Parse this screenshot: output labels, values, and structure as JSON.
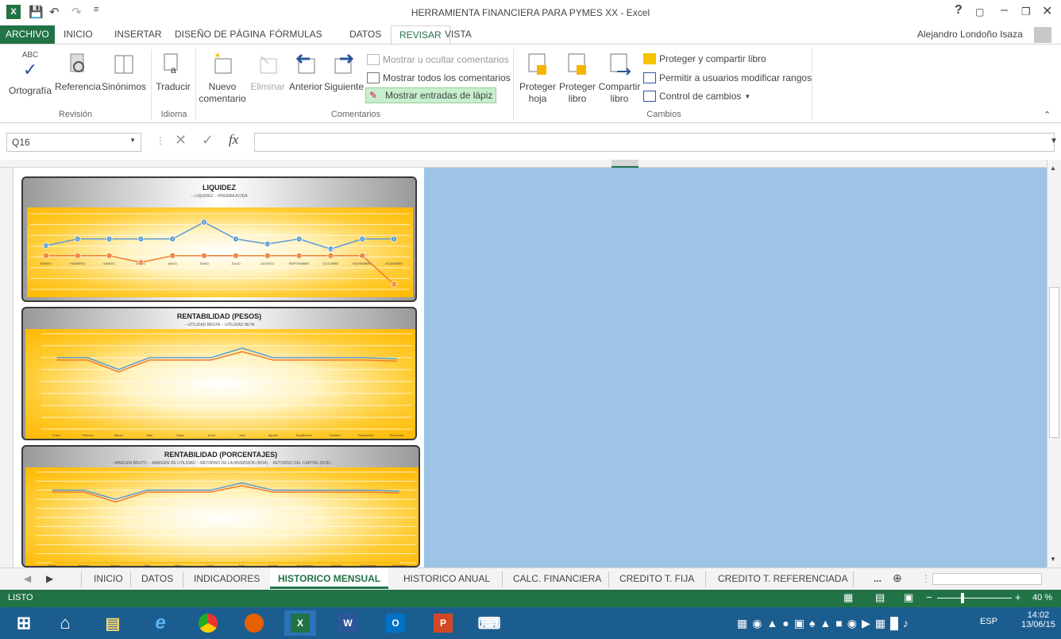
{
  "window": {
    "title": "HERRAMIENTA FINANCIERA PARA PYMES XX - Excel",
    "user": "Alejandro Londoño Isaza",
    "help": "?"
  },
  "tabs": [
    "ARCHIVO",
    "INICIO",
    "INSERTAR",
    "DISEÑO DE PÁGINA",
    "FÓRMULAS",
    "DATOS",
    "REVISAR",
    "VISTA"
  ],
  "ribbon": {
    "groups": {
      "revision": "Revisión",
      "idioma": "Idioma",
      "comentarios": "Comentarios",
      "cambios": "Cambios"
    },
    "abc": "ABC",
    "ortografia": "Ortografía",
    "referencia": "Referencia",
    "sinonimos": "Sinónimos",
    "traducir": "Traducir",
    "nuevo1": "Nuevo",
    "nuevo2": "comentario",
    "eliminar": "Eliminar",
    "anterior": "Anterior",
    "siguiente": "Siguiente",
    "mostrar_ocultar": "Mostrar u ocultar comentarios",
    "mostrar_todos": "Mostrar todos los comentarios",
    "mostrar_lapiz": "Mostrar entradas de lápiz",
    "proteger_hoja1": "Proteger",
    "proteger_hoja2": "hoja",
    "proteger_libro1": "Proteger",
    "proteger_libro2": "libro",
    "compartir1": "Compartir",
    "compartir2": "libro",
    "proteger_compartir": "Proteger y compartir libro",
    "permitir": "Permitir a usuarios modificar rangos",
    "control": "Control de cambios"
  },
  "formula": {
    "namebox": "Q16",
    "fx": "fx",
    "value": ""
  },
  "charts": {
    "liquidez": {
      "title": "LIQUIDEZ",
      "legend": [
        "LIQUIDEZ",
        "PRUEBA ACIDA"
      ]
    },
    "rent_pesos": {
      "title": "RENTABILIDAD (PESOS)",
      "legend": [
        "UTILIDAD BRUTA",
        "UTILIDAD NETA"
      ]
    },
    "rent_pct": {
      "title": "RENTABILIDAD (PORCENTAJES)",
      "legend": [
        "MARGEN BRUTO",
        "MARGEN DE UTILIDAD",
        "RETORNO DE LA INVERSIÓN (ROA)",
        "RETORNO DEL CAPITAL (ROE)"
      ]
    }
  },
  "chart_data": [
    {
      "type": "line",
      "title": "LIQUIDEZ",
      "categories": [
        "ENERO",
        "FEBRERO",
        "MARZO",
        "ABRIL",
        "MAYO",
        "JUNIO",
        "JULIO",
        "AGOSTO",
        "SEPTIEMBRE",
        "OCTUBRE",
        "NOVIEMBRE",
        "DICIEMBRE"
      ],
      "series": [
        {
          "name": "LIQUIDEZ",
          "values": [
            1.6,
            2,
            2,
            2,
            2,
            3,
            2,
            1.7,
            2,
            1.4,
            2,
            2
          ]
        },
        {
          "name": "PRUEBA ACIDA",
          "values": [
            1,
            1,
            1,
            0.6,
            1,
            1,
            1,
            1,
            1,
            1,
            1,
            -0.7
          ]
        }
      ],
      "ylim": [
        -1,
        3.5
      ]
    },
    {
      "type": "line",
      "title": "RENTABILIDAD (PESOS)",
      "categories": [
        "Enero",
        "Febrero",
        "Marzo",
        "Abril",
        "Mayo",
        "Junio",
        "Julio",
        "Agosto",
        "Septiembre",
        "Octubre",
        "Noviembre",
        "Diciembre"
      ],
      "series": [
        {
          "name": "UTILIDAD BRUTA",
          "values": [
            600,
            600,
            500,
            600,
            600,
            600,
            680,
            600,
            600,
            600,
            600,
            590
          ]
        },
        {
          "name": "UTILIDAD NETA",
          "values": [
            580,
            580,
            480,
            580,
            580,
            580,
            650,
            580,
            580,
            580,
            580,
            570
          ]
        }
      ],
      "ylim": [
        0,
        800
      ]
    },
    {
      "type": "line",
      "title": "RENTABILIDAD (PORCENTAJES)",
      "categories": [
        "Enero",
        "Febrero",
        "Marzo",
        "Abril",
        "Mayo",
        "Junio",
        "Julio",
        "Agosto",
        "Septiembre",
        "Octubre",
        "Noviembre",
        "Diciembre"
      ],
      "series": [
        {
          "name": "MARGEN BRUTO",
          "values": [
            80,
            80,
            70,
            80,
            80,
            80,
            88,
            80,
            80,
            80,
            80,
            79
          ]
        },
        {
          "name": "MARGEN DE UTILIDAD",
          "values": [
            78,
            78,
            67,
            78,
            78,
            78,
            85,
            78,
            78,
            78,
            78,
            77
          ]
        },
        {
          "name": "RETORNO DE LA INVERSIÓN (ROA)",
          "values": [
            0,
            0,
            0,
            0,
            0,
            0,
            0,
            0,
            0,
            0,
            0,
            0
          ]
        },
        {
          "name": "RETORNO DEL CAPITAL (ROE)",
          "values": [
            0,
            0,
            0,
            0,
            0,
            0,
            0,
            0,
            0,
            0,
            0,
            0
          ]
        }
      ],
      "ylim": [
        0,
        100
      ]
    }
  ],
  "sheets": [
    "INICIO",
    "DATOS",
    "INDICADORES",
    "HISTORICO MENSUAL",
    "HISTORICO ANUAL",
    "CALC. FINANCIERA",
    "CREDITO T. FIJA",
    "CREDITO T. REFERENCIADA"
  ],
  "more_sheets": "...",
  "status": {
    "mode": "LISTO",
    "zoom": "40 %"
  },
  "taskbar": {
    "lang": "ESP",
    "time": "14:02",
    "date": "13/06/15"
  },
  "colors": {
    "excel_green": "#217346",
    "sheet_blue": "#9dc3e6",
    "liquidez": "#5b9bd5",
    "acida": "#ed7d31"
  }
}
